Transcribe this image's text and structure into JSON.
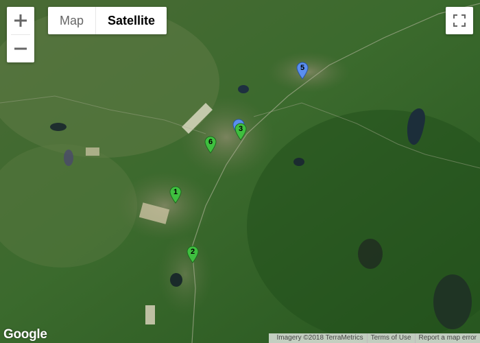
{
  "controls": {
    "zoom_in_symbol": "+",
    "zoom_out_symbol": "−",
    "map_type": {
      "options": [
        "Map",
        "Satellite"
      ],
      "selected": "Satellite"
    }
  },
  "markers": [
    {
      "label": "1",
      "color": "#3fbf3f"
    },
    {
      "label": "2",
      "color": "#3fbf3f"
    },
    {
      "label": "3",
      "color": "#3fbf3f"
    },
    {
      "label": "5",
      "color": "#5a8ff0"
    },
    {
      "label": "6",
      "color": "#3fbf3f"
    },
    {
      "label": "",
      "color": "#5a8ff0"
    }
  ],
  "footer": {
    "logo": "Google",
    "imagery": "Imagery ©2018 TerraMetrics",
    "terms": "Terms of Use",
    "report": "Report a map error"
  },
  "colors": {
    "green_marker": "#3fbf3f",
    "blue_marker": "#5a8ff0",
    "forest": "#2f5a24"
  }
}
